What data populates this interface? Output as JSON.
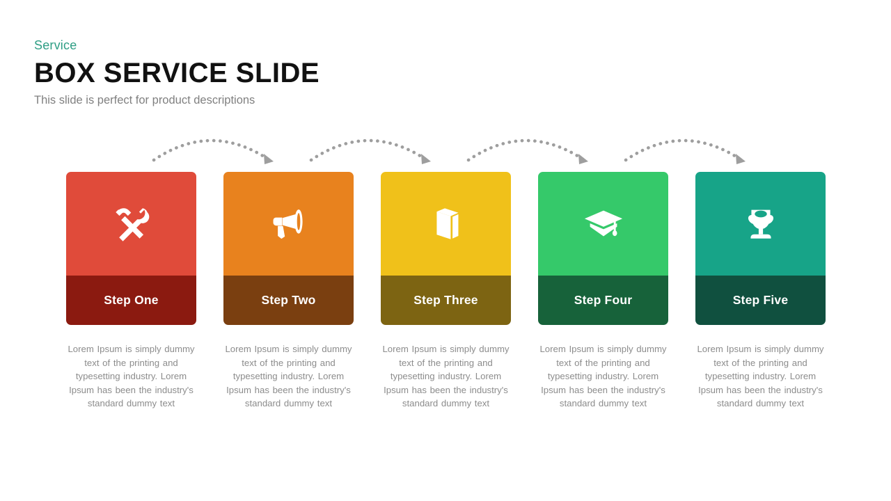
{
  "header": {
    "eyebrow": "Service",
    "title": "BOX SERVICE SLIDE",
    "subtitle": "This slide is perfect for product descriptions",
    "eyebrow_color": "#2e9e84",
    "title_color": "#111111",
    "subtitle_color": "#808080"
  },
  "body_text": "Lorem Ipsum is simply dummy text of the printing and typesetting industry. Lorem Ipsum has been the industry's standard dummy text",
  "cards": [
    {
      "label": "Step One",
      "icon": "hammer-wrench-icon",
      "top_color": "#e04b3a",
      "bottom_color": "#8b1a10",
      "description": "Lorem Ipsum is simply dummy text of the printing and typesetting industry. Lorem Ipsum has been the industry's standard dummy text"
    },
    {
      "label": "Step Two",
      "icon": "megaphone-icon",
      "top_color": "#e8821e",
      "bottom_color": "#7a3f10",
      "description": "Lorem Ipsum is simply dummy text of the printing and typesetting industry. Lorem Ipsum has been the industry's standard dummy text"
    },
    {
      "label": "Step Three",
      "icon": "book-icon",
      "top_color": "#f0c11a",
      "bottom_color": "#7d6412",
      "description": "Lorem Ipsum is simply dummy text of the printing and typesetting industry. Lorem Ipsum has been the industry's standard dummy text"
    },
    {
      "label": "Step Four",
      "icon": "graduation-cap-icon",
      "top_color": "#35c96a",
      "bottom_color": "#17623a",
      "description": "Lorem Ipsum is simply dummy text of the printing and typesetting industry. Lorem Ipsum has been the industry's standard dummy text"
    },
    {
      "label": "Step Five",
      "icon": "trophy-icon",
      "top_color": "#17a488",
      "bottom_color": "#10503f",
      "description": "Lorem Ipsum is simply dummy text of the printing and typesetting industry. Lorem Ipsum has been the industry's standard dummy text"
    }
  ],
  "connectors": {
    "count": 4,
    "style": "dotted-arc-arrow",
    "color": "#9e9e9e"
  },
  "background_color": "#ffffff"
}
